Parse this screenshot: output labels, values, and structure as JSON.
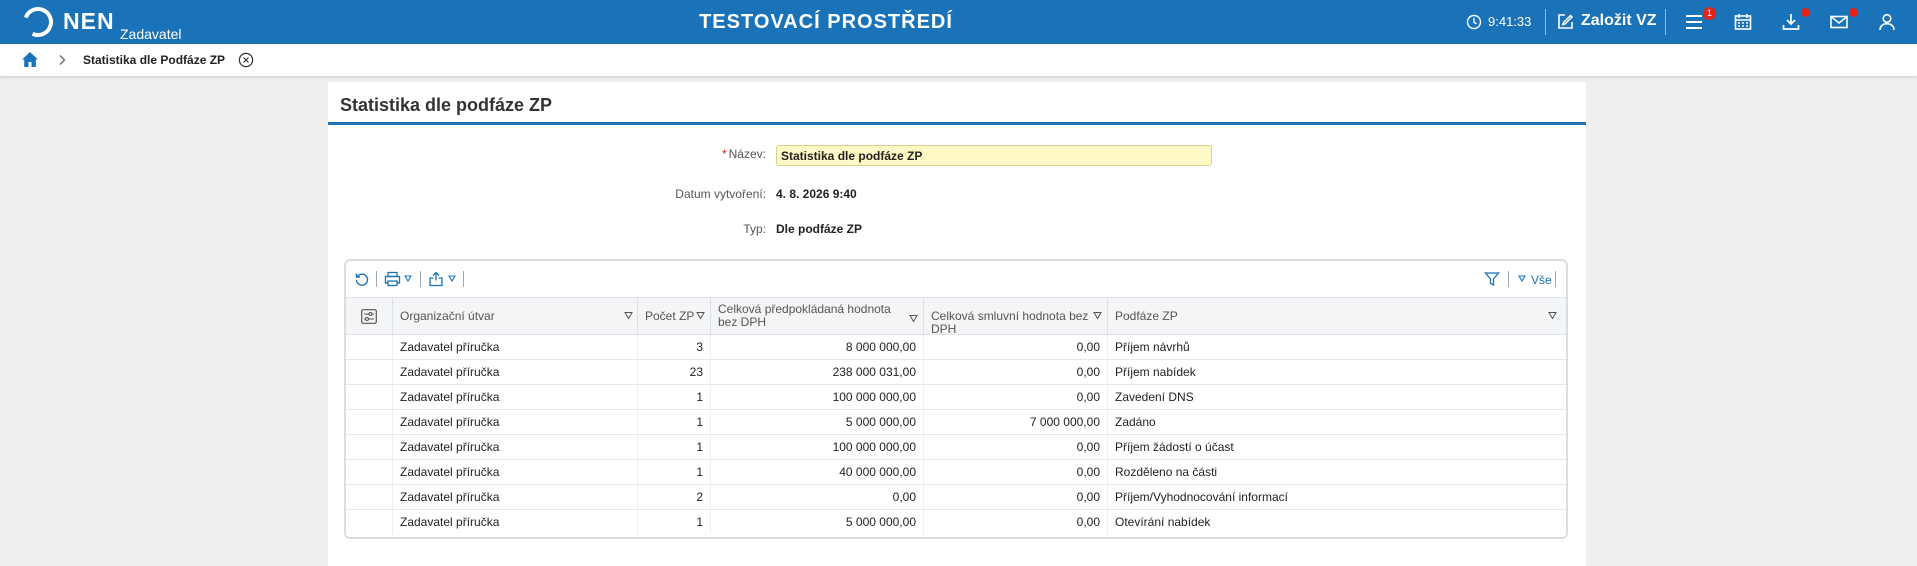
{
  "header": {
    "logo_text": "NEN",
    "logo_sub": "Zadavatel",
    "env_title": "TESTOVACÍ PROSTŘEDÍ",
    "time": "9:41:33",
    "create_label": "Založit VZ",
    "menu_badge": "1",
    "accent_color": "#1a73b8",
    "badge_color": "#e2231a"
  },
  "breadcrumb": {
    "current": "Statistika dle Podfáze ZP"
  },
  "panel": {
    "title": "Statistika dle podfáze ZP",
    "name_label": "Název:",
    "name_value": "Statistika dle podfáze ZP",
    "created_label": "Datum vytvoření:",
    "created_value": "4. 8. 2026 9:40",
    "type_label": "Typ:",
    "type_value": "Dle podfáze ZP"
  },
  "grid": {
    "filter_label": "Vše",
    "columns": [
      "Organizační útvar",
      "Počet ZP",
      "Celková předpokládaná hodnota bez DPH",
      "Celková smluvní hodnota bez DPH",
      "Podfáze ZP"
    ],
    "rows": [
      [
        "Zadavatel příručka",
        "3",
        "8 000 000,00",
        "0,00",
        "Příjem návrhů"
      ],
      [
        "Zadavatel příručka",
        "23",
        "238 000 031,00",
        "0,00",
        "Příjem nabídek"
      ],
      [
        "Zadavatel příručka",
        "1",
        "100 000 000,00",
        "0,00",
        "Zavedení DNS"
      ],
      [
        "Zadavatel příručka",
        "1",
        "5 000 000,00",
        "7 000 000,00",
        "Zadáno"
      ],
      [
        "Zadavatel příručka",
        "1",
        "100 000 000,00",
        "0,00",
        "Příjem žádostí o účast"
      ],
      [
        "Zadavatel příručka",
        "1",
        "40 000 000,00",
        "0,00",
        "Rozděleno na části"
      ],
      [
        "Zadavatel příručka",
        "2",
        "0,00",
        "0,00",
        "Příjem/Vyhodnocování informací"
      ],
      [
        "Zadavatel příručka",
        "1",
        "5 000 000,00",
        "0,00",
        "Otevírání nabídek"
      ]
    ]
  }
}
